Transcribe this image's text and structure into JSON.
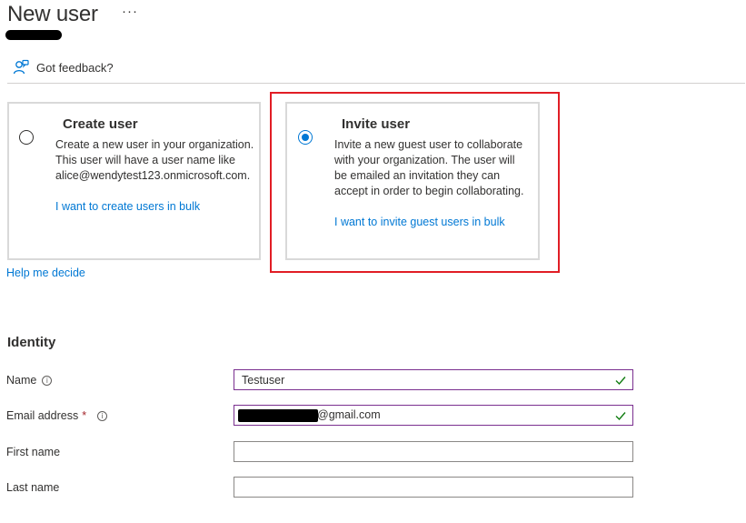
{
  "header": {
    "title": "New user",
    "more_label": "···",
    "feedback_label": "Got feedback?"
  },
  "options": {
    "create": {
      "title": "Create user",
      "description": "Create a new user in your organization. This user will have a user name like alice@wendytest123.onmicrosoft.com.",
      "link": "I want to create users in bulk",
      "selected": false
    },
    "invite": {
      "title": "Invite user",
      "description": "Invite a new guest user to collaborate with your organization. The user will be emailed an invitation they can accept in order to begin collaborating.",
      "link": "I want to invite guest users in bulk",
      "selected": true
    },
    "help_link": "Help me decide"
  },
  "identity": {
    "section_title": "Identity",
    "name": {
      "label": "Name",
      "value": "Testuser"
    },
    "email": {
      "label": "Email address",
      "required_mark": "*",
      "value_suffix": "@gmail.com"
    },
    "first_name": {
      "label": "First name",
      "value": ""
    },
    "last_name": {
      "label": "Last name",
      "value": ""
    }
  },
  "icons": {
    "info": "info-icon",
    "check": "checkmark-icon",
    "feedback": "feedback-person-icon"
  },
  "colors": {
    "accent": "#0078d4",
    "highlight": "#e11d25",
    "valid_check": "#107c10",
    "valid_border": "#7a2f8f"
  }
}
